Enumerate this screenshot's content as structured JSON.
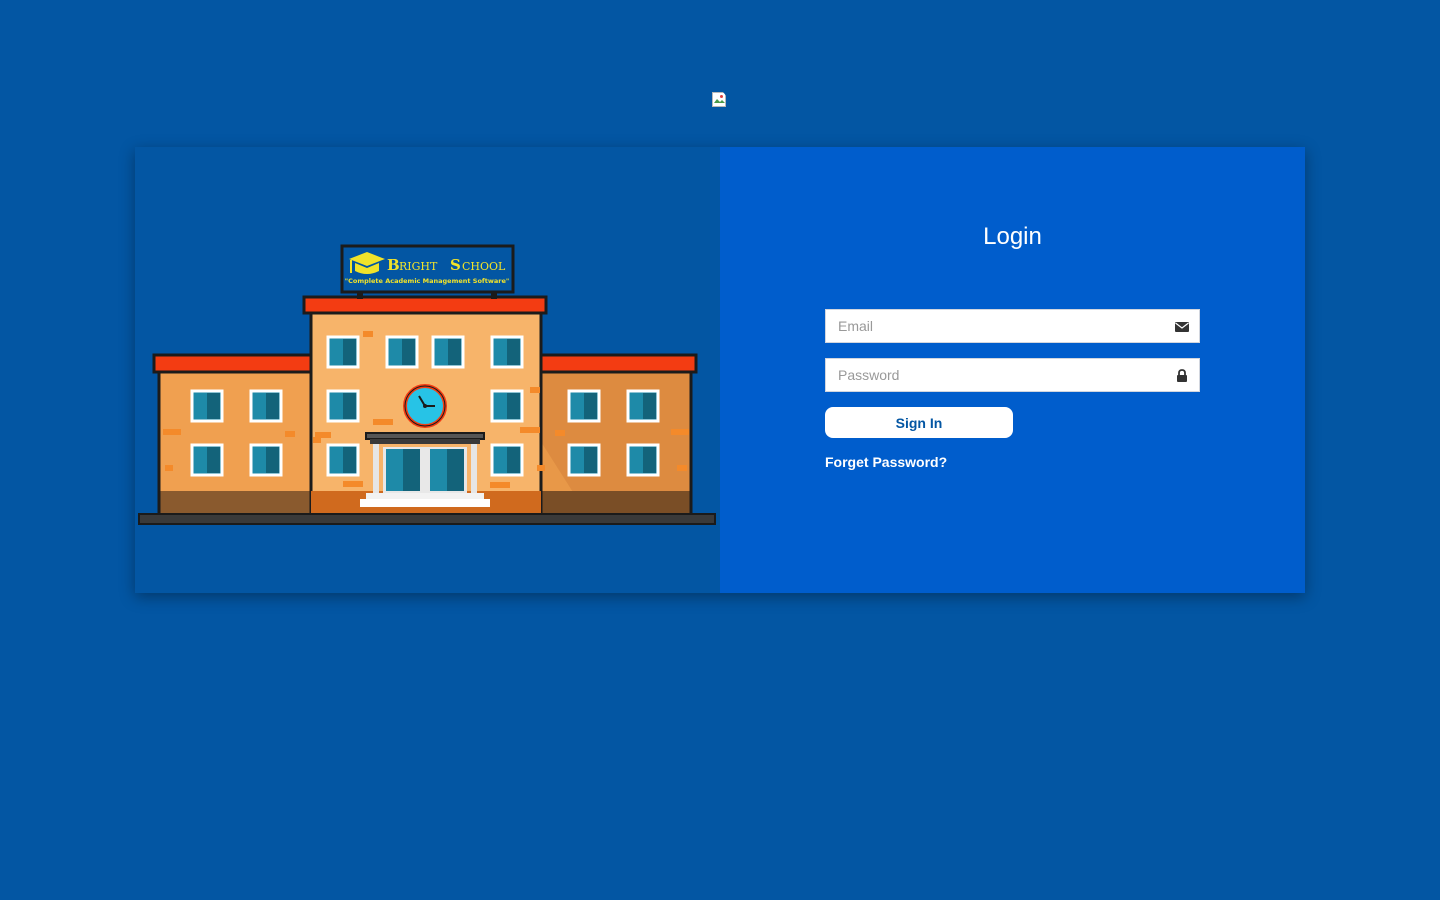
{
  "header": {
    "logo_icon": "broken-image-icon"
  },
  "illustration": {
    "sign_title_first": "B",
    "sign_title_rest": "RIGHT ",
    "sign_title_second": "S",
    "sign_title_second_rest": "CHOOL",
    "sign_tagline": "\"Complete Academic Management Software\"",
    "colors": {
      "roof": "#f33c12",
      "wall": "#f0a050",
      "wall_center": "#f7b46a",
      "window": "#1e8aa8",
      "sign_bg": "#0356a3",
      "sign_text": "#f1e32a"
    }
  },
  "login": {
    "title": "Login",
    "email_placeholder": "Email",
    "email_icon": "envelope-icon",
    "password_placeholder": "Password",
    "password_icon": "lock-icon",
    "sign_in_label": "Sign In",
    "forget_password_label": "Forget Password?"
  },
  "colors": {
    "background": "#0356a3",
    "form_panel": "#005dcc",
    "button_text": "#0356a3"
  }
}
